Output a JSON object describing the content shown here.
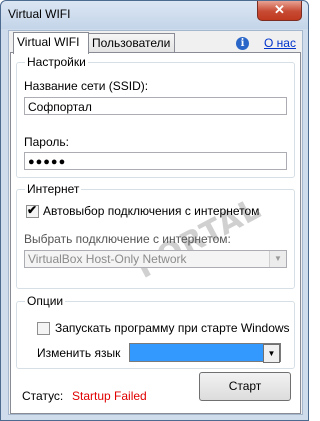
{
  "window": {
    "title": "Virtual WIFI",
    "close_glyph": "✕"
  },
  "tabs": [
    {
      "label": "Virtual WIFI",
      "active": true
    },
    {
      "label": "Пользователи",
      "active": false
    }
  ],
  "about_link": "О нас",
  "info_icon": "i",
  "settings": {
    "group_label": "Настройки",
    "ssid_label": "Название сети (SSID):",
    "ssid_value": "Софпортал",
    "password_label": "Пароль:",
    "password_value": "●●●●●"
  },
  "internet": {
    "group_label": "Интернет",
    "auto_select_label": "Автовыбор подключения с интернетом",
    "auto_select_checked": true,
    "select_connection_label": "Выбрать подключение с интернетом:",
    "connection_value": "VirtualBox Host-Only Network"
  },
  "options": {
    "group_label": "Опции",
    "startup_label": "Запускать программу при старте Windows",
    "startup_checked": false,
    "language_label": "Изменить язык",
    "language_value": ""
  },
  "status": {
    "label": "Статус:",
    "value": "Startup Failed"
  },
  "start_button": "Старт",
  "watermark": "PORTAL",
  "colors": {
    "status_error": "#e00000",
    "link": "#0033cc",
    "selection": "#3399ff"
  }
}
